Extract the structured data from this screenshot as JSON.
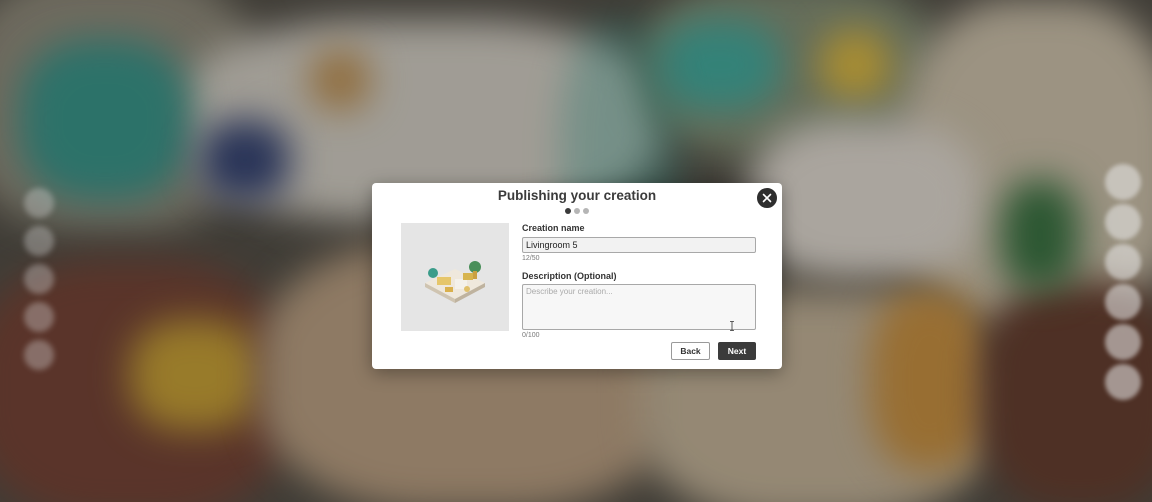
{
  "dialog": {
    "title": "Publishing your creation",
    "step_indicator": {
      "current": 1,
      "total": 3
    }
  },
  "preview": {
    "icon": "room-preview-icon"
  },
  "form": {
    "name_label": "Creation name",
    "name_value": "Livingroom 5",
    "name_counter": "12/50",
    "description_label": "Description (Optional)",
    "description_placeholder": "Describe your creation...",
    "description_value": "",
    "description_counter": "0/100"
  },
  "buttons": {
    "back_label": "Back",
    "next_label": "Next"
  },
  "icons": {
    "close": "close-icon",
    "cursor": "text-cursor-icon"
  },
  "colors": {
    "primary_button": "#3b3b3b",
    "modal_bg": "#ffffff"
  }
}
